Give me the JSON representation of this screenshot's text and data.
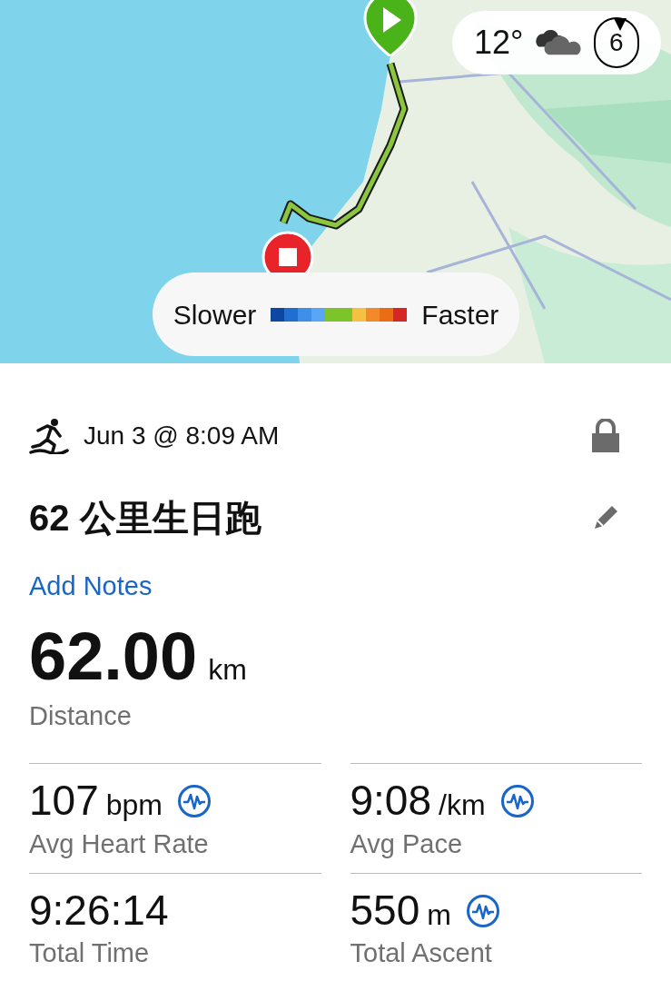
{
  "map": {
    "weather": {
      "temperature": "12°",
      "wind": "6"
    },
    "legend": {
      "slow_label": "Slower",
      "fast_label": "Faster",
      "colors": [
        {
          "color": "#0d47a1"
        },
        {
          "color": "#1e6fd0"
        },
        {
          "color": "#3f8ee8"
        },
        {
          "color": "#58a6f5"
        },
        {
          "color": "#7cc42a"
        },
        {
          "color": "#7cc42a"
        },
        {
          "color": "#f6c143"
        },
        {
          "color": "#f28a2b"
        },
        {
          "color": "#e86d14"
        },
        {
          "color": "#d62728"
        }
      ]
    }
  },
  "activity": {
    "date": "Jun 3 @ 8:09 AM",
    "private": true,
    "title": "62 公里生日跑",
    "notes_link": "Add Notes"
  },
  "distance": {
    "value": "62.00",
    "unit": "km",
    "label": "Distance"
  },
  "stats": [
    {
      "value": "107",
      "unit": "bpm",
      "label": "Avg Heart Rate",
      "chart_link": true
    },
    {
      "value": "9:08",
      "unit": "/km",
      "label": "Avg Pace",
      "chart_link": true
    },
    {
      "value": "9:26:14",
      "label": "Total Time",
      "chart_link": false
    },
    {
      "value": "550",
      "unit": "m",
      "label": "Total Ascent",
      "chart_link": true
    }
  ]
}
